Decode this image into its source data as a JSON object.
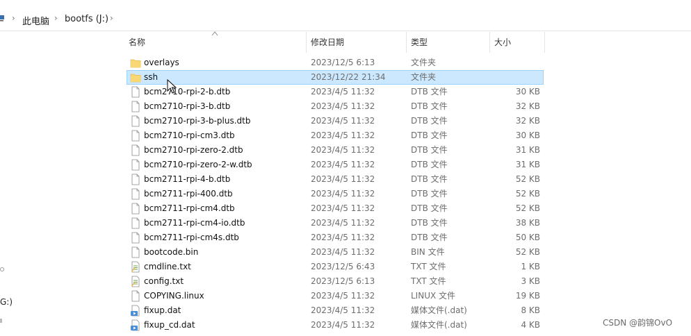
{
  "breadcrumb": {
    "items": [
      "此电脑",
      "bootfs (J:)"
    ],
    "separator": "›"
  },
  "nav": {
    "drive_fragment": "G:)"
  },
  "columns": {
    "name": "名称",
    "date": "修改日期",
    "type": "类型",
    "size": "大小"
  },
  "files": [
    {
      "name": "overlays",
      "date": "2023/12/5 6:13",
      "type": "文件夹",
      "size": "",
      "icon": "folder-icon",
      "selected": false
    },
    {
      "name": "ssh",
      "date": "2023/12/22 21:34",
      "type": "文件夹",
      "size": "",
      "icon": "folder-icon",
      "selected": true
    },
    {
      "name": "bcm2710-rpi-2-b.dtb",
      "date": "2023/4/5 11:32",
      "type": "DTB 文件",
      "size": "30 KB",
      "icon": "file-icon",
      "selected": false
    },
    {
      "name": "bcm2710-rpi-3-b.dtb",
      "date": "2023/4/5 11:32",
      "type": "DTB 文件",
      "size": "32 KB",
      "icon": "file-icon",
      "selected": false
    },
    {
      "name": "bcm2710-rpi-3-b-plus.dtb",
      "date": "2023/4/5 11:32",
      "type": "DTB 文件",
      "size": "32 KB",
      "icon": "file-icon",
      "selected": false
    },
    {
      "name": "bcm2710-rpi-cm3.dtb",
      "date": "2023/4/5 11:32",
      "type": "DTB 文件",
      "size": "30 KB",
      "icon": "file-icon",
      "selected": false
    },
    {
      "name": "bcm2710-rpi-zero-2.dtb",
      "date": "2023/4/5 11:32",
      "type": "DTB 文件",
      "size": "31 KB",
      "icon": "file-icon",
      "selected": false
    },
    {
      "name": "bcm2710-rpi-zero-2-w.dtb",
      "date": "2023/4/5 11:32",
      "type": "DTB 文件",
      "size": "31 KB",
      "icon": "file-icon",
      "selected": false
    },
    {
      "name": "bcm2711-rpi-4-b.dtb",
      "date": "2023/4/5 11:32",
      "type": "DTB 文件",
      "size": "52 KB",
      "icon": "file-icon",
      "selected": false
    },
    {
      "name": "bcm2711-rpi-400.dtb",
      "date": "2023/4/5 11:32",
      "type": "DTB 文件",
      "size": "52 KB",
      "icon": "file-icon",
      "selected": false
    },
    {
      "name": "bcm2711-rpi-cm4.dtb",
      "date": "2023/4/5 11:32",
      "type": "DTB 文件",
      "size": "52 KB",
      "icon": "file-icon",
      "selected": false
    },
    {
      "name": "bcm2711-rpi-cm4-io.dtb",
      "date": "2023/4/5 11:32",
      "type": "DTB 文件",
      "size": "38 KB",
      "icon": "file-icon",
      "selected": false
    },
    {
      "name": "bcm2711-rpi-cm4s.dtb",
      "date": "2023/4/5 11:32",
      "type": "DTB 文件",
      "size": "50 KB",
      "icon": "file-icon",
      "selected": false
    },
    {
      "name": "bootcode.bin",
      "date": "2023/4/5 11:32",
      "type": "BIN 文件",
      "size": "52 KB",
      "icon": "file-icon",
      "selected": false
    },
    {
      "name": "cmdline.txt",
      "date": "2023/12/5 6:43",
      "type": "TXT 文件",
      "size": "1 KB",
      "icon": "text-file-icon",
      "selected": false
    },
    {
      "name": "config.txt",
      "date": "2023/12/5 6:13",
      "type": "TXT 文件",
      "size": "3 KB",
      "icon": "text-file-icon",
      "selected": false
    },
    {
      "name": "COPYING.linux",
      "date": "2023/4/5 11:32",
      "type": "LINUX 文件",
      "size": "19 KB",
      "icon": "file-icon",
      "selected": false
    },
    {
      "name": "fixup.dat",
      "date": "2023/4/5 11:32",
      "type": "媒体文件(.dat)",
      "size": "8 KB",
      "icon": "media-file-icon",
      "selected": false
    },
    {
      "name": "fixup_cd.dat",
      "date": "2023/4/5 11:32",
      "type": "媒体文件(.dat)",
      "size": "4 KB",
      "icon": "media-file-icon",
      "selected": false
    }
  ],
  "watermark": "CSDN @韵锦OvO",
  "colors": {
    "selection_bg": "#cce8ff",
    "selection_border": "#99d1ff",
    "folder": "#f8d775",
    "folder_dark": "#e8b94a",
    "media_blue": "#4a90d9"
  }
}
